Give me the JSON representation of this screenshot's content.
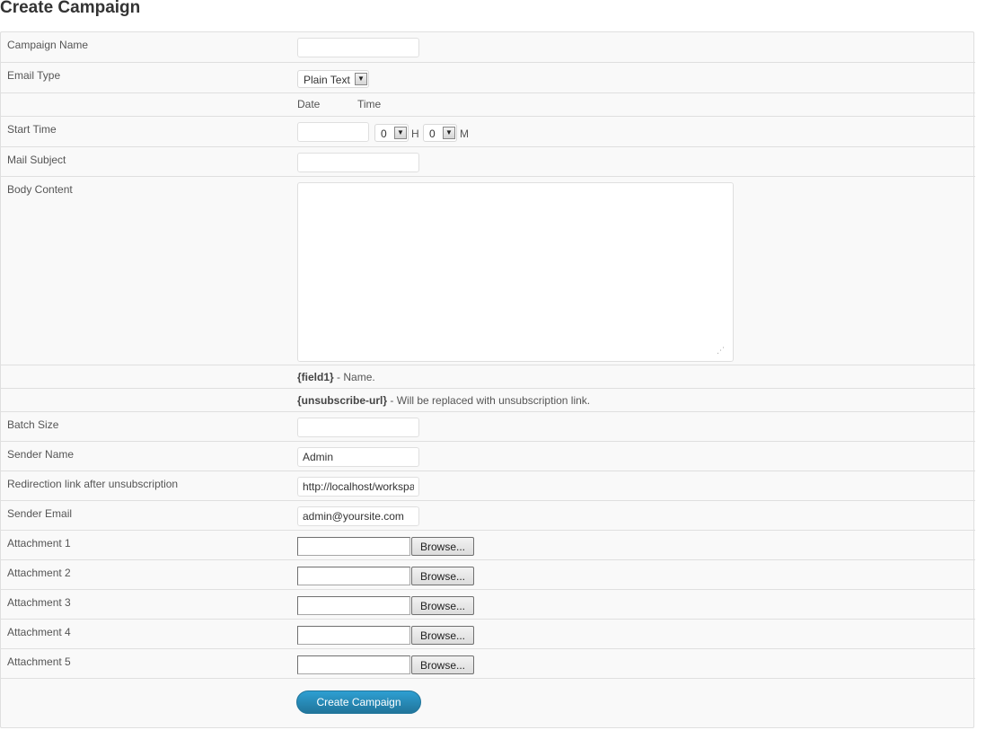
{
  "page": {
    "title": "Create Campaign"
  },
  "form": {
    "campaign_name": {
      "label": "Campaign Name",
      "value": ""
    },
    "email_type": {
      "label": "Email Type",
      "value": "Plain Text"
    },
    "date_header": "Date",
    "time_header": "Time",
    "start_time": {
      "label": "Start Time",
      "date_value": "",
      "hour": "0",
      "hour_unit": "H",
      "minute": "0",
      "minute_unit": "M"
    },
    "mail_subject": {
      "label": "Mail Subject",
      "value": ""
    },
    "body_content": {
      "label": "Body Content",
      "value": ""
    },
    "hint_field1": {
      "token": "{field1}",
      "text": " - Name."
    },
    "hint_unsubscribe": {
      "token": "{unsubscribe-url}",
      "text": " - Will be replaced with unsubscription link."
    },
    "batch_size": {
      "label": "Batch Size",
      "value": ""
    },
    "sender_name": {
      "label": "Sender Name",
      "value": "Admin"
    },
    "redirection_link": {
      "label": "Redirection link after unsubscription",
      "value": "http://localhost/workspa"
    },
    "sender_email": {
      "label": "Sender Email",
      "value": "admin@yoursite.com"
    },
    "attachments": [
      {
        "label": "Attachment 1",
        "button": "Browse..."
      },
      {
        "label": "Attachment 2",
        "button": "Browse..."
      },
      {
        "label": "Attachment 3",
        "button": "Browse..."
      },
      {
        "label": "Attachment 4",
        "button": "Browse..."
      },
      {
        "label": "Attachment 5",
        "button": "Browse..."
      }
    ],
    "submit_label": "Create Campaign"
  },
  "colors": {
    "accent": "#21759b",
    "border": "#dfdfdf",
    "row_bg": "#f9f9f9"
  }
}
